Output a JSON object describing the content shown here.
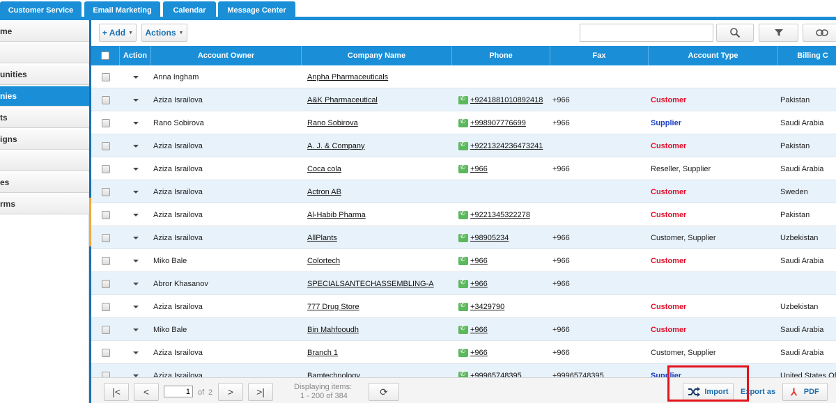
{
  "tabs": [
    "Customer Service",
    "Email Marketing",
    "Calendar",
    "Message Center"
  ],
  "sidebar": {
    "items": [
      {
        "label": "me",
        "active": false
      },
      {
        "label": "",
        "active": false
      },
      {
        "label": "unities",
        "active": false
      },
      {
        "label": "nies",
        "active": true
      },
      {
        "label": "ts",
        "active": false
      },
      {
        "label": "igns",
        "active": false
      },
      {
        "label": "",
        "active": false
      },
      {
        "label": "es",
        "active": false
      },
      {
        "label": "rms",
        "active": false
      }
    ]
  },
  "toolbar": {
    "add_label": "+ Add",
    "actions_label": "Actions",
    "search_placeholder": ""
  },
  "columns": [
    "Action",
    "Account Owner",
    "Company Name",
    "Phone",
    "Fax",
    "Account Type",
    "Billing C"
  ],
  "rows": [
    {
      "owner": "Anna Ingham",
      "company": "Anpha Pharmaceuticals",
      "phone": "",
      "fax": "",
      "type": "",
      "type_style": "",
      "country": ""
    },
    {
      "owner": "Aziza Israilova",
      "company": "A&K Pharmaceutical",
      "phone": "+9241881010892418",
      "fax": "+966",
      "type": "Customer",
      "type_style": "red",
      "country": "Pakistan"
    },
    {
      "owner": "Rano Sobirova",
      "company": "Rano Sobirova",
      "phone": "+998907776699",
      "fax": "+966",
      "type": "Supplier",
      "type_style": "blue",
      "country": "Saudi Arabia"
    },
    {
      "owner": "Aziza Israilova",
      "company": "A. J. & Company",
      "phone": "+9221324236473241",
      "fax": "",
      "type": "Customer",
      "type_style": "red",
      "country": "Pakistan"
    },
    {
      "owner": "Aziza Israilova",
      "company": "Coca cola",
      "phone": "+966",
      "fax": "+966",
      "type": "Reseller, Supplier",
      "type_style": "",
      "country": "Saudi Arabia"
    },
    {
      "owner": "Aziza Israilova",
      "company": "Actron AB",
      "phone": "",
      "fax": "",
      "type": "Customer",
      "type_style": "red",
      "country": "Sweden"
    },
    {
      "owner": "Aziza Israilova",
      "company": "Al-Habib Pharma",
      "phone": "+9221345322278",
      "fax": "",
      "type": "Customer",
      "type_style": "red",
      "country": "Pakistan"
    },
    {
      "owner": "Aziza Israilova",
      "company": "AllPlants",
      "phone": "+98905234",
      "fax": "+966",
      "type": "Customer, Supplier",
      "type_style": "",
      "country": "Uzbekistan"
    },
    {
      "owner": "Miko Bale",
      "company": "Colortech",
      "phone": "+966",
      "fax": "+966",
      "type": "Customer",
      "type_style": "red",
      "country": "Saudi Arabia"
    },
    {
      "owner": "Abror Khasanov",
      "company": "SPECIALSANTECHASSEMBLING-A",
      "phone": "+966",
      "fax": "+966",
      "type": "",
      "type_style": "",
      "country": ""
    },
    {
      "owner": "Aziza Israilova",
      "company": "777 Drug Store",
      "phone": "+3429790",
      "fax": "",
      "type": "Customer",
      "type_style": "red",
      "country": "Uzbekistan"
    },
    {
      "owner": "Miko Bale",
      "company": "Bin Mahfooudh",
      "phone": "+966",
      "fax": "+966",
      "type": "Customer",
      "type_style": "red",
      "country": "Saudi Arabia"
    },
    {
      "owner": "Aziza Israilova",
      "company": "Branch 1",
      "phone": "+966",
      "fax": "+966",
      "type": "Customer, Supplier",
      "type_style": "",
      "country": "Saudi Arabia"
    },
    {
      "owner": "Aziza Israilova",
      "company": "Bamtechnology",
      "phone": "+99965748395",
      "fax": "+99965748395",
      "type": "Supplier",
      "type_style": "blue",
      "country": "United States Of"
    }
  ],
  "pager": {
    "page": "1",
    "of_label": "of",
    "total_pages": "2",
    "display_line1": "Displaying items:",
    "display_line2": "1 - 200 of 384"
  },
  "footer": {
    "import_label": "Import",
    "export_label": "Export as",
    "pdf_label": "PDF"
  },
  "colors": {
    "accent": "#1a8fd8",
    "customer": "#e0102a",
    "supplier": "#1c3fbf",
    "highlight": "#e3131b"
  }
}
